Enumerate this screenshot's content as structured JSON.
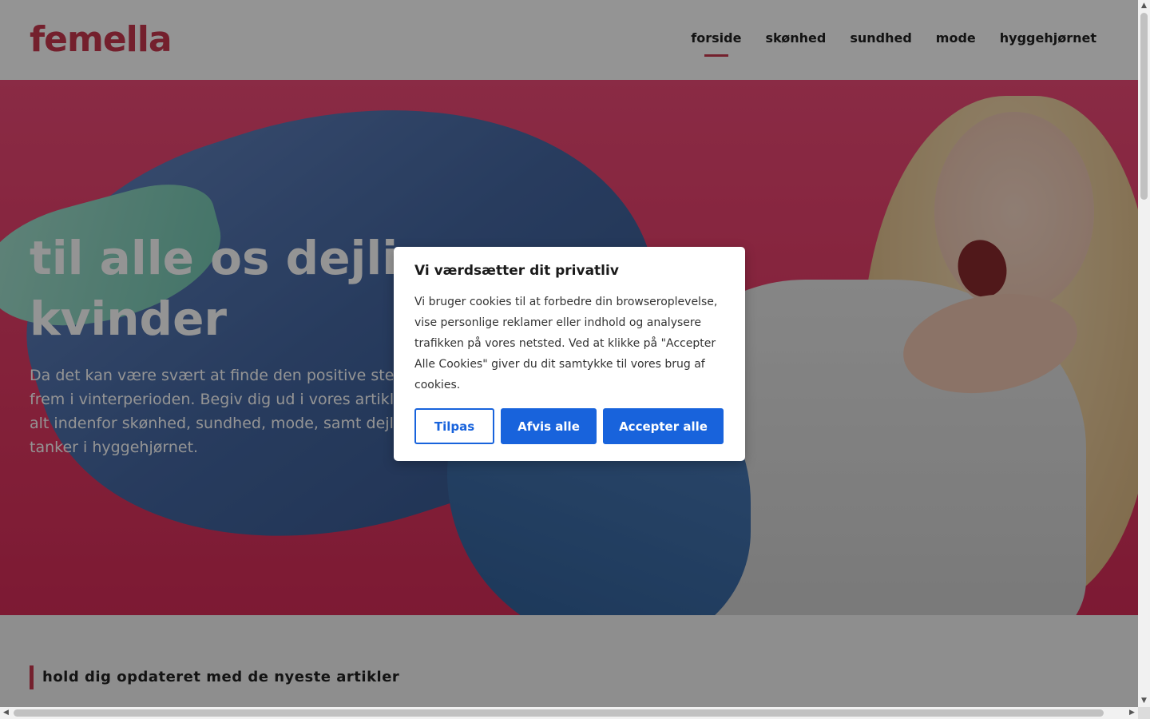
{
  "header": {
    "logo": "femella",
    "nav": [
      "forside",
      "skønhed",
      "sundhed",
      "mode",
      "hyggehjørnet"
    ],
    "active_nav": "forside",
    "accent_color": "#c8384e"
  },
  "hero": {
    "title": "til alle os dejlige kvinder",
    "text": "Da det kan være svært at finde den positive stemning frem i vinterperioden. Begiv dig ud i vores artikler om alt indenfor skønhed, sundhed, mode, samt dejlige tanker i hyggehjørnet."
  },
  "section": {
    "heading": "hold dig opdateret med de nyeste artikler"
  },
  "cookie_modal": {
    "title": "Vi værdsætter dit privatliv",
    "text": "Vi bruger cookies til at forbedre din browseroplevelse, vise personlige reklamer eller indhold og analysere trafikken på vores netsted. Ved at klikke på \"Accepter Alle Cookies\" giver du dit samtykke til vores brug af cookies.",
    "buttons": {
      "customize": "Tilpas",
      "reject": "Afvis alle",
      "accept": "Accepter alle"
    },
    "button_color": "#1863dc"
  },
  "scrollbars": {
    "up_icon": "arrow-up-icon",
    "down_icon": "arrow-down-icon",
    "left_icon": "arrow-left-icon",
    "right_icon": "arrow-right-icon"
  }
}
